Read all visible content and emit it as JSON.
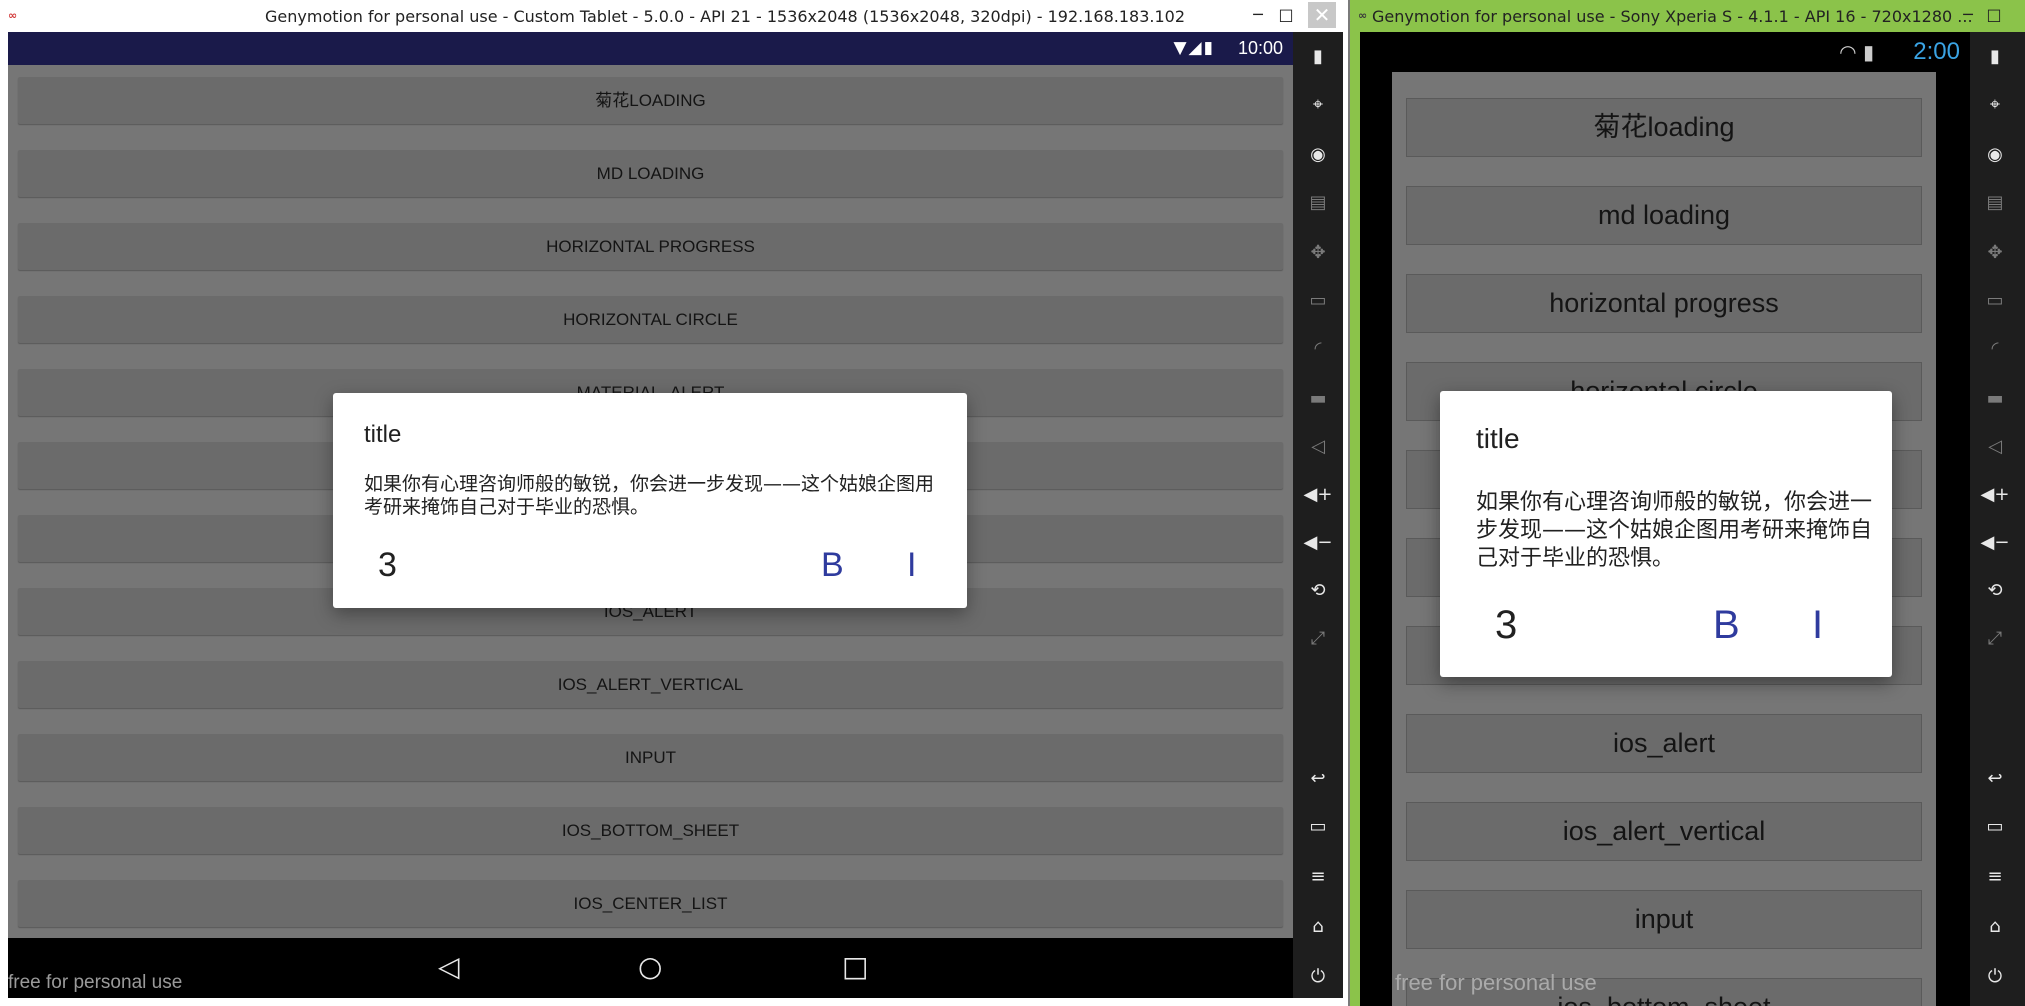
{
  "win1": {
    "title": "Genymotion for personal use - Custom Tablet - 5.0.0 - API 21 - 1536x2048 (1536x2048, 320dpi) - 192.168.183.102",
    "time": "10:00",
    "buttons": [
      "菊花LOADING",
      "MD LOADING",
      "HORIZONTAL PROGRESS",
      "HORIZONTAL CIRCLE",
      "MATERIAL_ALERT",
      "",
      "",
      "IOS_ALERT",
      "IOS_ALERT_VERTICAL",
      "INPUT",
      "IOS_BOTTOM_SHEET",
      "IOS_CENTER_LIST"
    ],
    "watermark": "free for personal use",
    "dialog": {
      "title": "title",
      "message": "如果你有心理咨询师般的敏锐，你会进一步发现——这个姑娘企图用考研来掩饰自己对于毕业的恐惧。",
      "neutral": "3",
      "negative": "B",
      "positive": "I"
    }
  },
  "win2": {
    "title": "Genymotion for personal use - Sony Xperia S - 4.1.1 - API 16 - 720x1280 ...",
    "time": "2:00",
    "buttons": [
      "菊花loading",
      "md loading",
      "horizontal progress",
      "horizontal circle",
      "",
      "",
      "",
      "ios_alert",
      "ios_alert_vertical",
      "input",
      "ios_bottom_sheet"
    ],
    "watermark": "free for personal use",
    "dialog": {
      "title": "title",
      "message": "如果你有心理咨询师般的敏锐，你会进一步发现——这个姑娘企图用考研来掩饰自己对于毕业的恐惧。",
      "neutral": "3",
      "negative": "B",
      "positive": "I"
    }
  },
  "window_controls": {
    "minimize": "─",
    "maximize": "□",
    "close": "✕"
  },
  "nav": {
    "back": "◁",
    "home": "○",
    "recents": "□"
  },
  "sidebar_icons": [
    "battery-icon",
    "gps-icon",
    "webcam-icon",
    "media-icon",
    "dpad-icon",
    "id-icon",
    "rss-icon",
    "sms-icon",
    "share-icon",
    "volume-up-icon",
    "volume-down-icon",
    "rotate-icon",
    "scale-icon",
    "back-icon",
    "recent-icon",
    "menu-icon",
    "home-icon",
    "power-icon"
  ],
  "colors": {
    "accent": "#2f3b9e",
    "win2_frame": "#8bc34a",
    "statusbar1": "#1a1a4a",
    "time2": "#3aa3e3"
  }
}
